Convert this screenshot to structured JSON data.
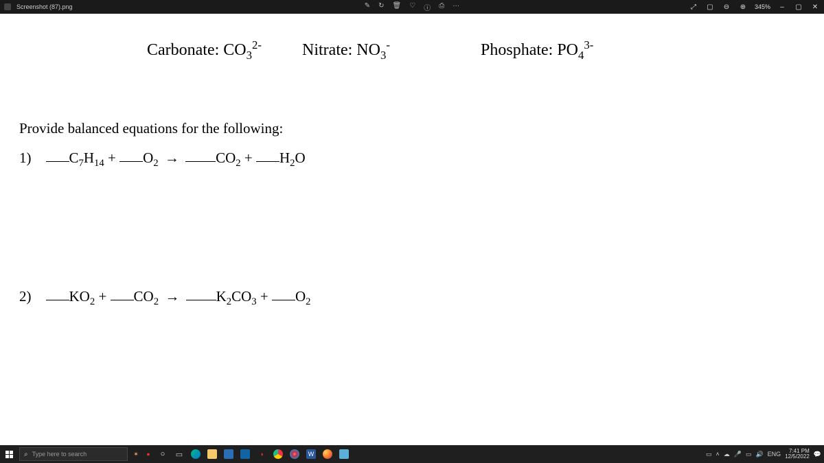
{
  "app": {
    "title": "Screenshot (87).png",
    "zoom": "345%"
  },
  "toolbar_icons": {
    "edit": "✎",
    "rotate": "↻",
    "delete": "🗑",
    "heart": "♡",
    "info": "ⓘ",
    "print": "⎙",
    "more": "···",
    "fullscreen": "⤢",
    "fit": "▢",
    "zoom_out": "⊖",
    "zoom_in": "⊕",
    "minimize": "–",
    "maximize": "▢",
    "close": "✕"
  },
  "doc": {
    "ions": {
      "carbonate_label": "Carbonate: CO",
      "carbonate_sub": "3",
      "carbonate_sup": "2-",
      "nitrate_label": "Nitrate: NO",
      "nitrate_sub": "3",
      "nitrate_sup": "-",
      "phosphate_label": "Phosphate: PO",
      "phosphate_sub": "4",
      "phosphate_sup": "3-"
    },
    "instruction": "Provide balanced equations for the following:",
    "q1": {
      "num": "1)",
      "r1a": "C",
      "r1b": "7",
      "r1c": "H",
      "r1d": "14",
      "plus1": " + ",
      "r2a": "O",
      "r2b": "2",
      "arrow": "→",
      "p1a": "CO",
      "p1b": "2",
      "plus2": " + ",
      "p2a": "H",
      "p2b": "2",
      "p2c": "O"
    },
    "q2": {
      "num": "2)",
      "r1a": "KO",
      "r1b": "2",
      "plus1": " + ",
      "r2a": "CO",
      "r2b": "2",
      "arrow": "→",
      "p1a": "K",
      "p1b": "2",
      "p1c": "CO",
      "p1d": "3",
      "plus2": " + ",
      "p2a": "O",
      "p2b": "2"
    }
  },
  "taskbar": {
    "search_placeholder": "Type here to search",
    "lang": "ENG",
    "time": "7:41 PM",
    "date": "12/5/2022"
  }
}
